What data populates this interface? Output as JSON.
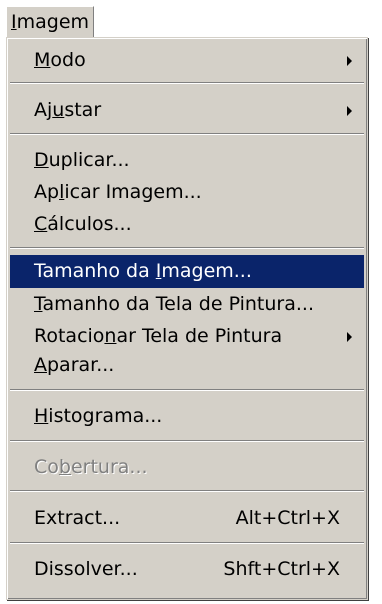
{
  "menubar": {
    "title_ul": "I",
    "title_rest": "magem"
  },
  "menu": {
    "modo": {
      "pre": "",
      "ul": "M",
      "post": "odo"
    },
    "ajustar": {
      "pre": "Aj",
      "ul": "u",
      "post": "star"
    },
    "duplicar": {
      "pre": "",
      "ul": "D",
      "post": "uplicar..."
    },
    "aplicar": {
      "pre": "Ap",
      "ul": "l",
      "post": "icar Imagem..."
    },
    "calculos": {
      "pre": "",
      "ul": "C",
      "post": "álculos..."
    },
    "tamanho_imagem": {
      "pre": "Tamanho da ",
      "ul": "I",
      "post": "magem..."
    },
    "tamanho_tela": {
      "pre": "",
      "ul": "T",
      "post": "amanho da Tela de Pintura..."
    },
    "rotacionar": {
      "pre": "Rotacio",
      "ul": "n",
      "post": "ar Tela de Pintura"
    },
    "aparar": {
      "pre": "",
      "ul": "A",
      "post": "parar..."
    },
    "histograma": {
      "pre": "",
      "ul": "H",
      "post": "istograma..."
    },
    "cobertura": {
      "pre": "Co",
      "ul": "b",
      "post": "ertura..."
    },
    "extract": {
      "label": "Extract...",
      "shortcut": "Alt+Ctrl+X"
    },
    "dissolver": {
      "label": "Dissolver...",
      "shortcut": "Shft+Ctrl+X"
    }
  }
}
